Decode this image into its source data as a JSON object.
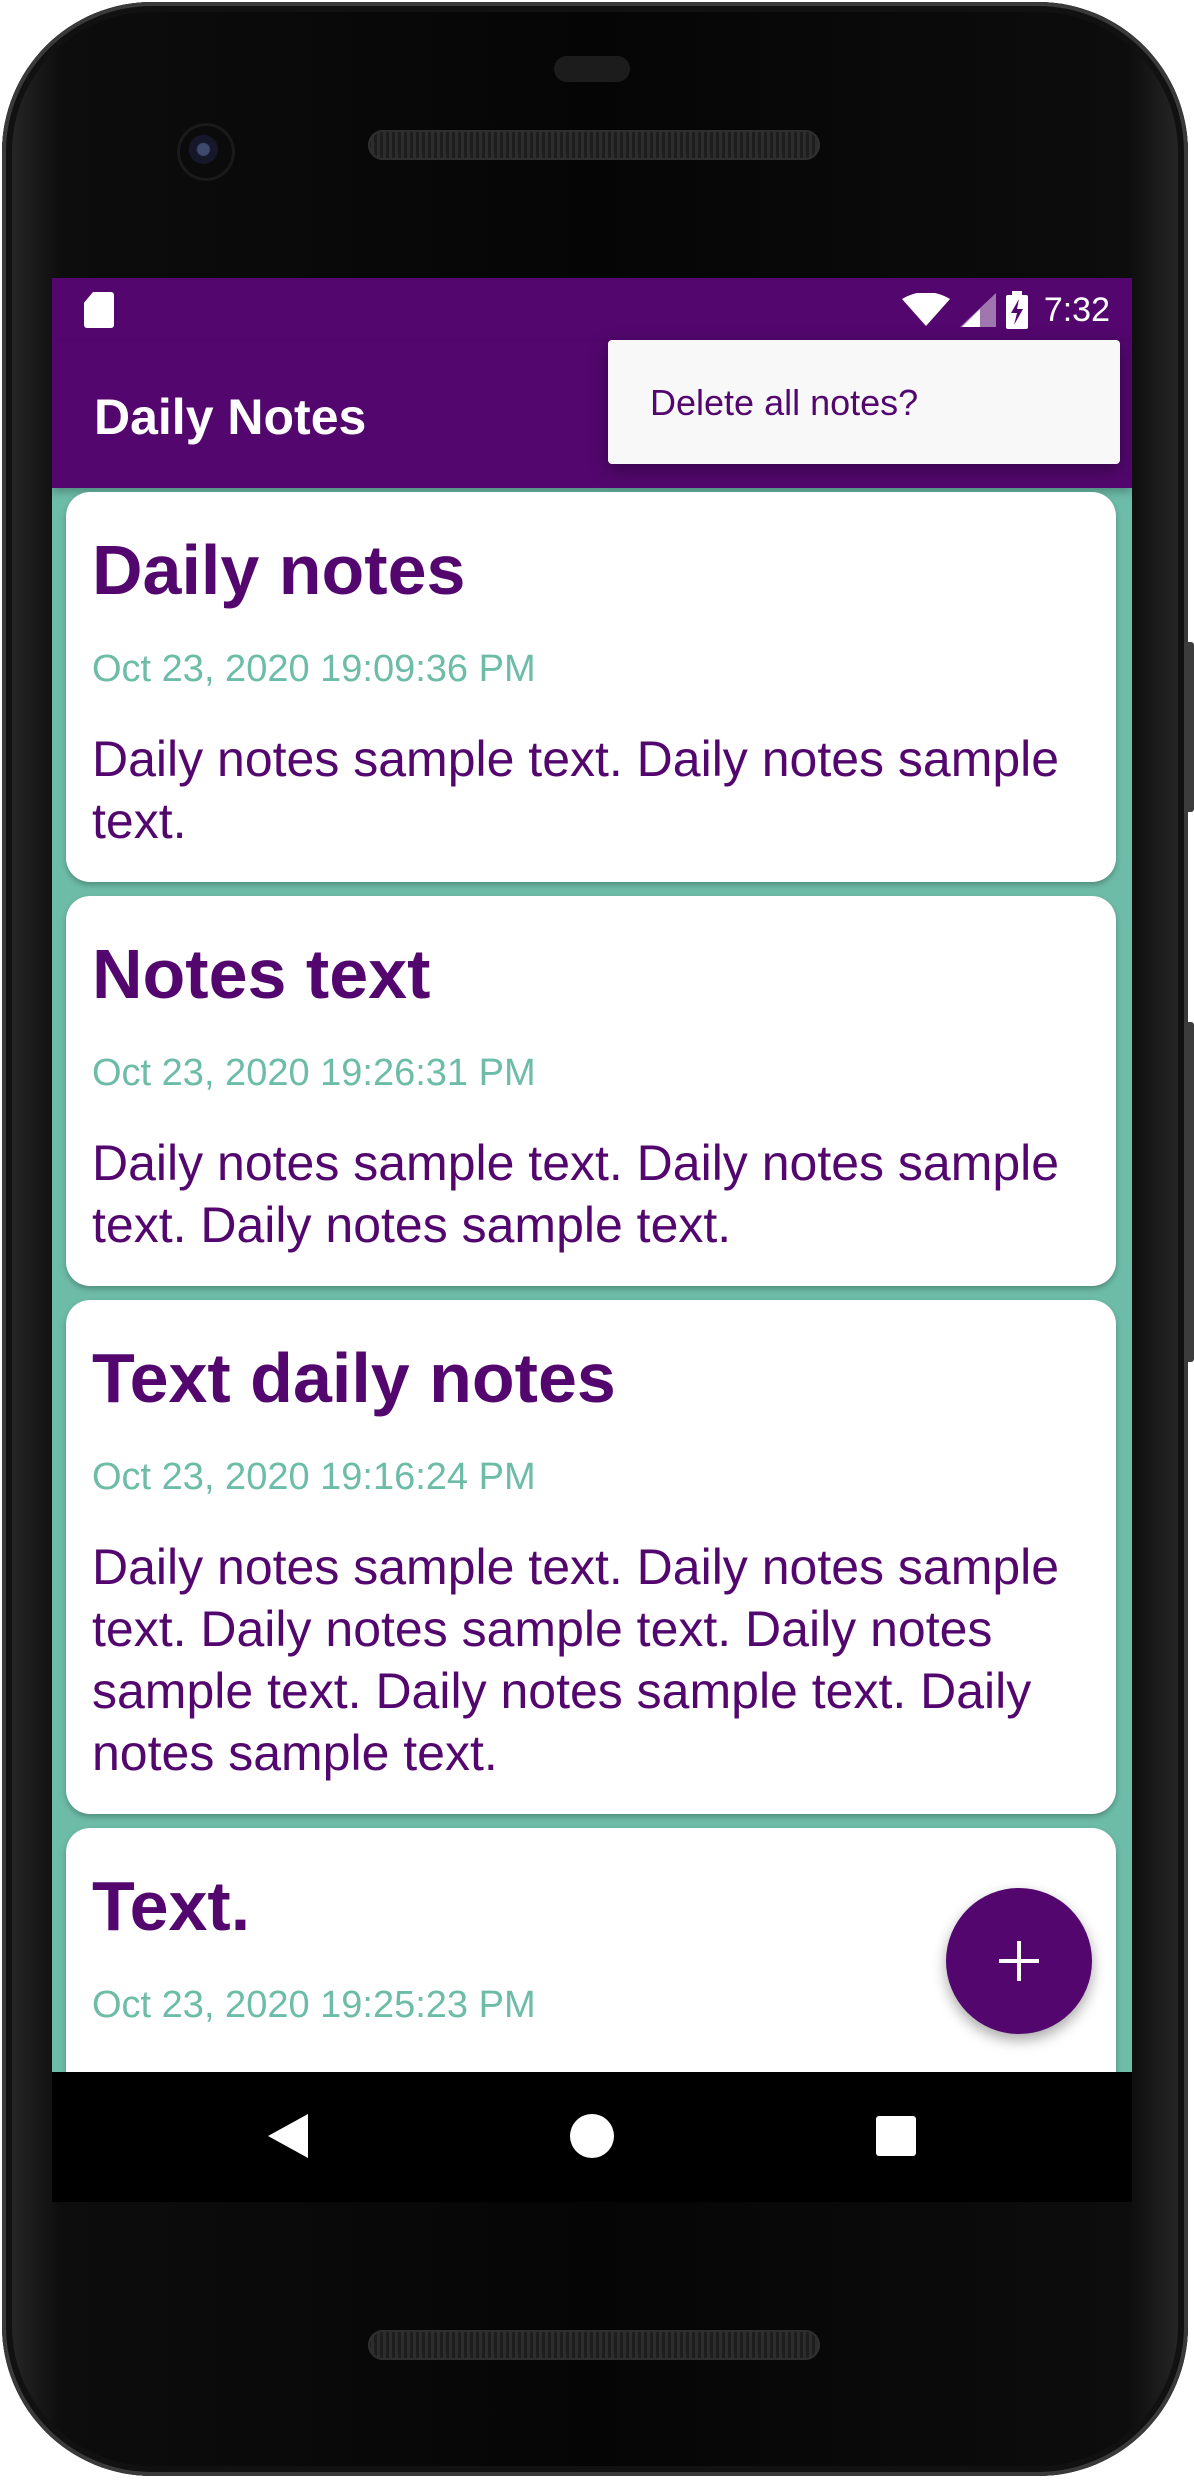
{
  "status_bar": {
    "time": "7:32",
    "icons": [
      "sd-card-icon",
      "wifi-icon",
      "signal-icon",
      "battery-charging-icon"
    ]
  },
  "app_bar": {
    "title": "Daily Notes"
  },
  "overflow_menu": {
    "items": [
      {
        "label": "Delete all notes?"
      }
    ]
  },
  "notes": [
    {
      "title": "Daily notes",
      "date": "Oct 23, 2020 19:09:36 PM",
      "body": "Daily notes sample text. Daily notes sample text."
    },
    {
      "title": "Notes text",
      "date": "Oct 23, 2020 19:26:31 PM",
      "body": "Daily notes sample text. Daily notes sample text. Daily notes sample text."
    },
    {
      "title": "Text daily notes",
      "date": "Oct 23, 2020 19:16:24 PM",
      "body": "Daily notes sample text. Daily notes sample text. Daily notes sample text. Daily notes sample text. Daily notes sample text. Daily notes sample text."
    },
    {
      "title": "Text.",
      "date": "Oct 23, 2020 19:25:23 PM",
      "body": ""
    }
  ],
  "fab": {
    "icon": "plus-icon"
  },
  "nav_bar": {
    "icons": [
      "back-icon",
      "home-icon",
      "recents-icon"
    ]
  },
  "colors": {
    "primary": "#53076e",
    "accent": "#6dbca8",
    "card": "#ffffff",
    "menu_bg": "#f8f8f8"
  }
}
